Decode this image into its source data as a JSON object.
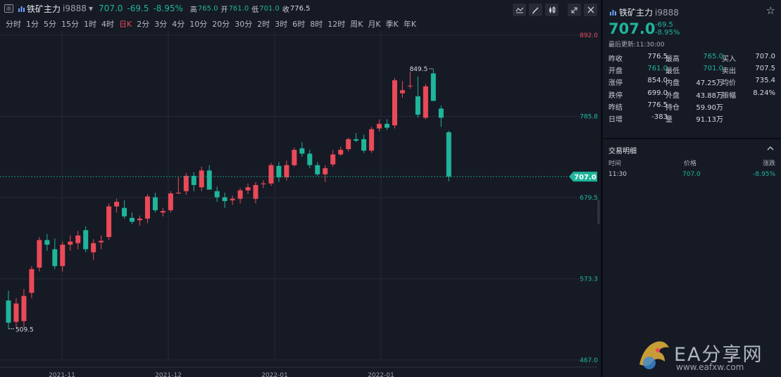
{
  "header": {
    "box_icon_text": "画",
    "name": "铁矿主力",
    "code": "i9888",
    "price": "707.0",
    "change": "-69.5",
    "change_pct": "-8.95%",
    "high_label": "高",
    "high": "765.0",
    "open_label": "开",
    "open": "761.0",
    "low_label": "低",
    "low": "701.0",
    "close_label": "收",
    "close": "776.5"
  },
  "periods": [
    "分时",
    "1分",
    "5分",
    "15分",
    "1时",
    "4时",
    "日K",
    "2分",
    "3分",
    "4分",
    "10分",
    "20分",
    "30分",
    "2时",
    "3时",
    "6时",
    "8时",
    "12时",
    "周K",
    "月K",
    "季K",
    "年K"
  ],
  "active_period": "日K",
  "chart_data": {
    "type": "candlestick",
    "y_ticks": [
      "892.0",
      "785.8",
      "679.5",
      "573.3",
      "467.0"
    ],
    "x_ticks": [
      "2021-11",
      "2021-12",
      "2022-01",
      "2022-01"
    ],
    "ylim": [
      467.0,
      892.0
    ],
    "last_price_label": "707.0",
    "high_annotation": "849.5",
    "low_annotation": "509.5",
    "up_color": "#ea4a58",
    "down_color": "#1fb59b",
    "candles": [
      {
        "o": 545,
        "h": 558,
        "l": 508,
        "c": 516
      },
      {
        "o": 517,
        "h": 548,
        "l": 510,
        "c": 541
      },
      {
        "o": 518,
        "h": 560,
        "l": 510,
        "c": 551
      },
      {
        "o": 555,
        "h": 590,
        "l": 548,
        "c": 586
      },
      {
        "o": 588,
        "h": 628,
        "l": 583,
        "c": 624
      },
      {
        "o": 624,
        "h": 632,
        "l": 610,
        "c": 618
      },
      {
        "o": 612,
        "h": 626,
        "l": 586,
        "c": 590
      },
      {
        "o": 590,
        "h": 622,
        "l": 583,
        "c": 618
      },
      {
        "o": 618,
        "h": 630,
        "l": 610,
        "c": 622
      },
      {
        "o": 620,
        "h": 636,
        "l": 612,
        "c": 630
      },
      {
        "o": 637,
        "h": 642,
        "l": 608,
        "c": 612
      },
      {
        "o": 608,
        "h": 625,
        "l": 598,
        "c": 620
      },
      {
        "o": 621,
        "h": 630,
        "l": 612,
        "c": 623
      },
      {
        "o": 628,
        "h": 672,
        "l": 624,
        "c": 668
      },
      {
        "o": 668,
        "h": 678,
        "l": 660,
        "c": 674
      },
      {
        "o": 666,
        "h": 676,
        "l": 652,
        "c": 655
      },
      {
        "o": 653,
        "h": 660,
        "l": 645,
        "c": 648
      },
      {
        "o": 650,
        "h": 656,
        "l": 643,
        "c": 652
      },
      {
        "o": 652,
        "h": 684,
        "l": 646,
        "c": 681
      },
      {
        "o": 680,
        "h": 686,
        "l": 660,
        "c": 663
      },
      {
        "o": 660,
        "h": 666,
        "l": 655,
        "c": 662
      },
      {
        "o": 663,
        "h": 688,
        "l": 660,
        "c": 685
      },
      {
        "o": 686,
        "h": 706,
        "l": 684,
        "c": 686
      },
      {
        "o": 688,
        "h": 712,
        "l": 683,
        "c": 708
      },
      {
        "o": 708,
        "h": 713,
        "l": 688,
        "c": 696
      },
      {
        "o": 693,
        "h": 720,
        "l": 688,
        "c": 715
      },
      {
        "o": 715,
        "h": 722,
        "l": 700,
        "c": 690
      },
      {
        "o": 688,
        "h": 694,
        "l": 674,
        "c": 680
      },
      {
        "o": 680,
        "h": 686,
        "l": 666,
        "c": 675
      },
      {
        "o": 676,
        "h": 682,
        "l": 670,
        "c": 678
      },
      {
        "o": 678,
        "h": 692,
        "l": 672,
        "c": 689
      },
      {
        "o": 689,
        "h": 698,
        "l": 684,
        "c": 693
      },
      {
        "o": 678,
        "h": 700,
        "l": 672,
        "c": 696
      },
      {
        "o": 697,
        "h": 702,
        "l": 692,
        "c": 698
      },
      {
        "o": 698,
        "h": 725,
        "l": 695,
        "c": 722
      },
      {
        "o": 721,
        "h": 726,
        "l": 700,
        "c": 706
      },
      {
        "o": 706,
        "h": 728,
        "l": 702,
        "c": 722
      },
      {
        "o": 722,
        "h": 745,
        "l": 720,
        "c": 742
      },
      {
        "o": 744,
        "h": 752,
        "l": 733,
        "c": 737
      },
      {
        "o": 737,
        "h": 742,
        "l": 718,
        "c": 722
      },
      {
        "o": 722,
        "h": 726,
        "l": 708,
        "c": 710
      },
      {
        "o": 710,
        "h": 722,
        "l": 700,
        "c": 718
      },
      {
        "o": 723,
        "h": 742,
        "l": 720,
        "c": 736
      },
      {
        "o": 736,
        "h": 746,
        "l": 734,
        "c": 742
      },
      {
        "o": 743,
        "h": 758,
        "l": 740,
        "c": 756
      },
      {
        "o": 756,
        "h": 764,
        "l": 752,
        "c": 754
      },
      {
        "o": 756,
        "h": 762,
        "l": 738,
        "c": 741
      },
      {
        "o": 741,
        "h": 772,
        "l": 738,
        "c": 769
      },
      {
        "o": 770,
        "h": 782,
        "l": 766,
        "c": 776
      },
      {
        "o": 776,
        "h": 782,
        "l": 768,
        "c": 771
      },
      {
        "o": 774,
        "h": 836,
        "l": 770,
        "c": 833
      },
      {
        "o": 816,
        "h": 832,
        "l": 810,
        "c": 820
      },
      {
        "o": 826,
        "h": 844,
        "l": 822,
        "c": 826
      },
      {
        "o": 812,
        "h": 838,
        "l": 784,
        "c": 788
      },
      {
        "o": 784,
        "h": 828,
        "l": 782,
        "c": 825
      },
      {
        "o": 842,
        "h": 848,
        "l": 806,
        "c": 806
      },
      {
        "o": 796,
        "h": 800,
        "l": 772,
        "c": 784
      },
      {
        "o": 765,
        "h": 767,
        "l": 701,
        "c": 707
      }
    ]
  },
  "quote": {
    "star_icon": "star-outline-icon",
    "update_label": "最后更新:",
    "update_time": "11:30:00",
    "rows": [
      {
        "l1": "昨收",
        "v1": "776.5",
        "l2": "最高",
        "v2": "765.0",
        "l3": "买入",
        "v3": "707.0"
      },
      {
        "l1": "开盘",
        "v1": "761.0",
        "l2": "最低",
        "v2": "701.0",
        "l3": "卖出",
        "v3": "707.5"
      },
      {
        "l1": "涨停",
        "v1": "854.0",
        "l2": "内盘",
        "v2": "47.25万",
        "l3": "均价",
        "v3": "735.4"
      },
      {
        "l1": "跌停",
        "v1": "699.0",
        "l2": "外盘",
        "v2": "43.88万",
        "l3": "振幅",
        "v3": "8.24%"
      },
      {
        "l1": "昨结",
        "v1": "776.5",
        "l2": "持仓",
        "v2": "59.90万",
        "l3": "",
        "v3": ""
      },
      {
        "l1": "日增",
        "v1": "-383",
        "l2": "量",
        "v2": "91.13万",
        "l3": "",
        "v3": ""
      }
    ],
    "row_colors": [
      [
        "neutral",
        "down",
        "neutral"
      ],
      [
        "down",
        "down",
        "neutral"
      ],
      [
        "neutral",
        "neutral",
        "neutral"
      ],
      [
        "neutral",
        "neutral",
        "neutral"
      ],
      [
        "neutral",
        "neutral",
        "neutral"
      ],
      [
        "neutral",
        "neutral",
        "neutral"
      ]
    ]
  },
  "trades": {
    "title": "交易明细",
    "columns": [
      "时间",
      "价格",
      "涨跌"
    ],
    "rows": [
      {
        "time": "11:30",
        "price": "707.0",
        "change": "-8.95%"
      }
    ]
  },
  "watermark": {
    "text": "EA分享网",
    "url": "www.eafxw.com"
  }
}
